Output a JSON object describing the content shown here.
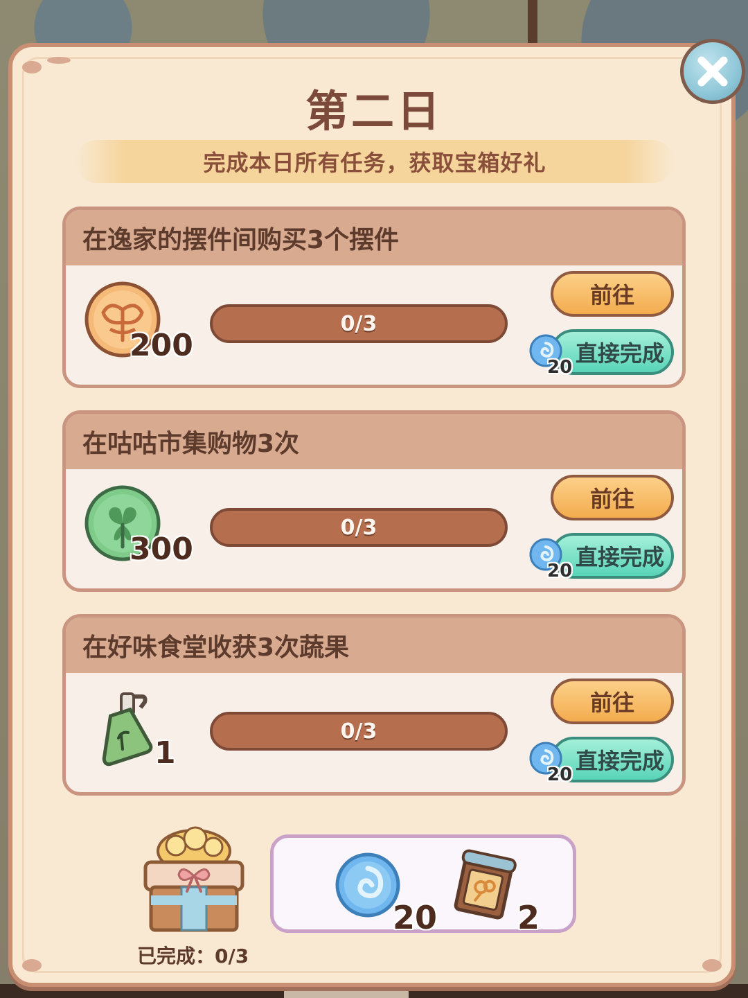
{
  "panel": {
    "title": "第二日",
    "subtitle": "完成本日所有任务，获取宝箱好礼"
  },
  "tasks": [
    {
      "title": "在逸家的摆件间购买3个摆件",
      "reward_icon": "orange-leaf-coin-icon",
      "reward_amount": "200",
      "progress_text": "0/3",
      "progress_fraction": 0,
      "goto_label": "前往",
      "complete_label": "直接完成",
      "complete_cost": "20"
    },
    {
      "title": "在咕咕市集购物3次",
      "reward_icon": "green-clover-coin-icon",
      "reward_amount": "300",
      "progress_text": "0/3",
      "progress_fraction": 0,
      "goto_label": "前往",
      "complete_label": "直接完成",
      "complete_cost": "20"
    },
    {
      "title": "在好味食堂收获3次蔬果",
      "reward_icon": "fertilizer-bottle-icon",
      "reward_amount": "1",
      "progress_text": "0/3",
      "progress_fraction": 0,
      "goto_label": "前往",
      "complete_label": "直接完成",
      "complete_cost": "20"
    }
  ],
  "chest": {
    "icon": "gift-chest-icon",
    "progress_label": "已完成：0/3"
  },
  "chest_rewards": [
    {
      "icon": "blue-swirl-gem-icon",
      "count": "20"
    },
    {
      "icon": "recipe-scroll-icon",
      "count": "2"
    }
  ],
  "colors": {
    "panel_bg": "#f9e9d2",
    "panel_border": "#c98f73",
    "header_bg": "#d8aa90",
    "goto_btn": "#f3ac4e",
    "complete_btn": "#59d4b8",
    "progress_track": "#b56f4f"
  }
}
